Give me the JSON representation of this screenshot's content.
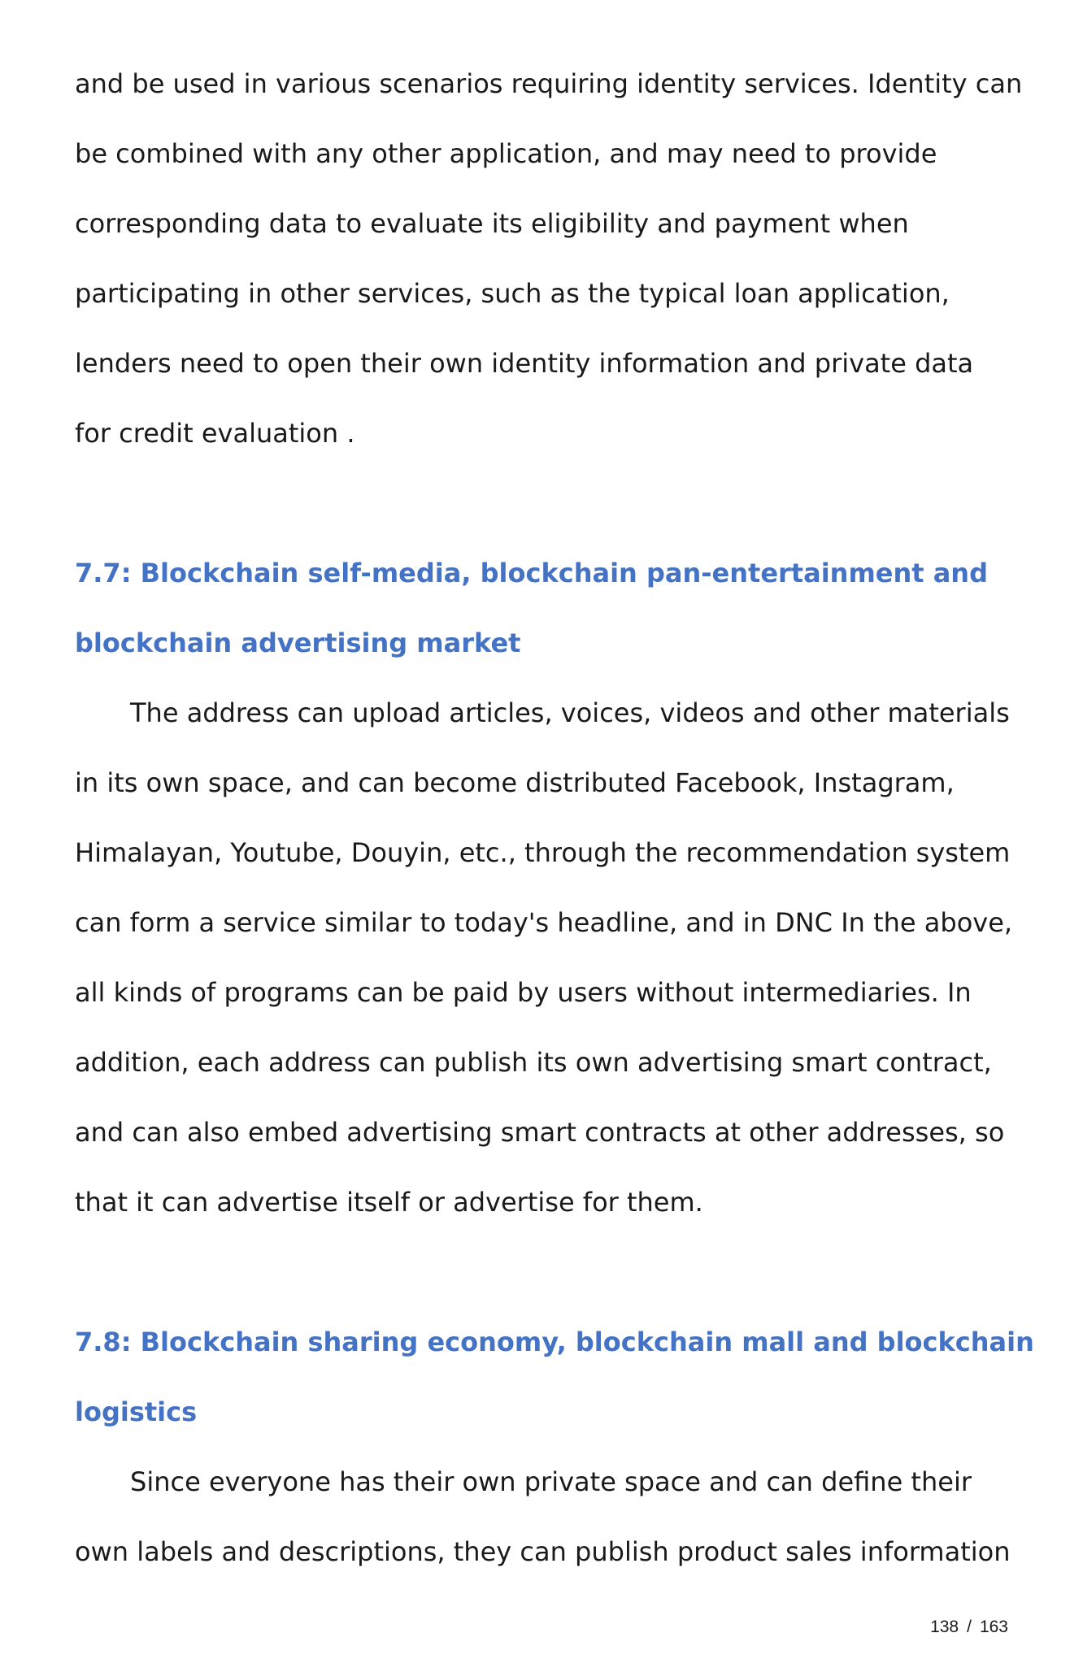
{
  "intro_paragraph": {
    "lines": [
      "and be used in various scenarios requiring identity services. Identity can",
      "be combined with any other application, and may need to provide",
      "corresponding data to evaluate its eligibility and payment when",
      "participating in other services, such as the typical loan application,",
      "lenders need to open their own identity information and private data",
      "for credit evaluation ."
    ]
  },
  "section_7_7": {
    "heading_lines": [
      "7.7: Blockchain self-media, blockchain pan-entertainment and",
      "blockchain advertising market"
    ],
    "body_lines": [
      "The address can upload articles, voices, videos and other materials",
      "in its own space, and can become distributed Facebook, Instagram,",
      "Himalayan, Youtube, Douyin, etc., through the recommendation system",
      "can form a service similar to today's headline, and in DNC In the above,",
      "all kinds of programs can be paid by users without intermediaries. In",
      "addition, each address can publish its own advertising smart contract,",
      "and can also embed advertising smart contracts at other addresses, so",
      "that it can advertise itself or advertise for them."
    ]
  },
  "section_7_8": {
    "heading_lines": [
      "7.8: Blockchain sharing economy, blockchain mall and blockchain",
      "logistics"
    ],
    "body_lines": [
      "Since everyone has their own private space and can define their",
      "own labels and descriptions, they can publish product sales information"
    ]
  },
  "footer": {
    "current_page": "138",
    "separator": "/",
    "total_pages": "163"
  },
  "colors": {
    "heading": "#4472c4",
    "text": "#1a1a1a"
  }
}
